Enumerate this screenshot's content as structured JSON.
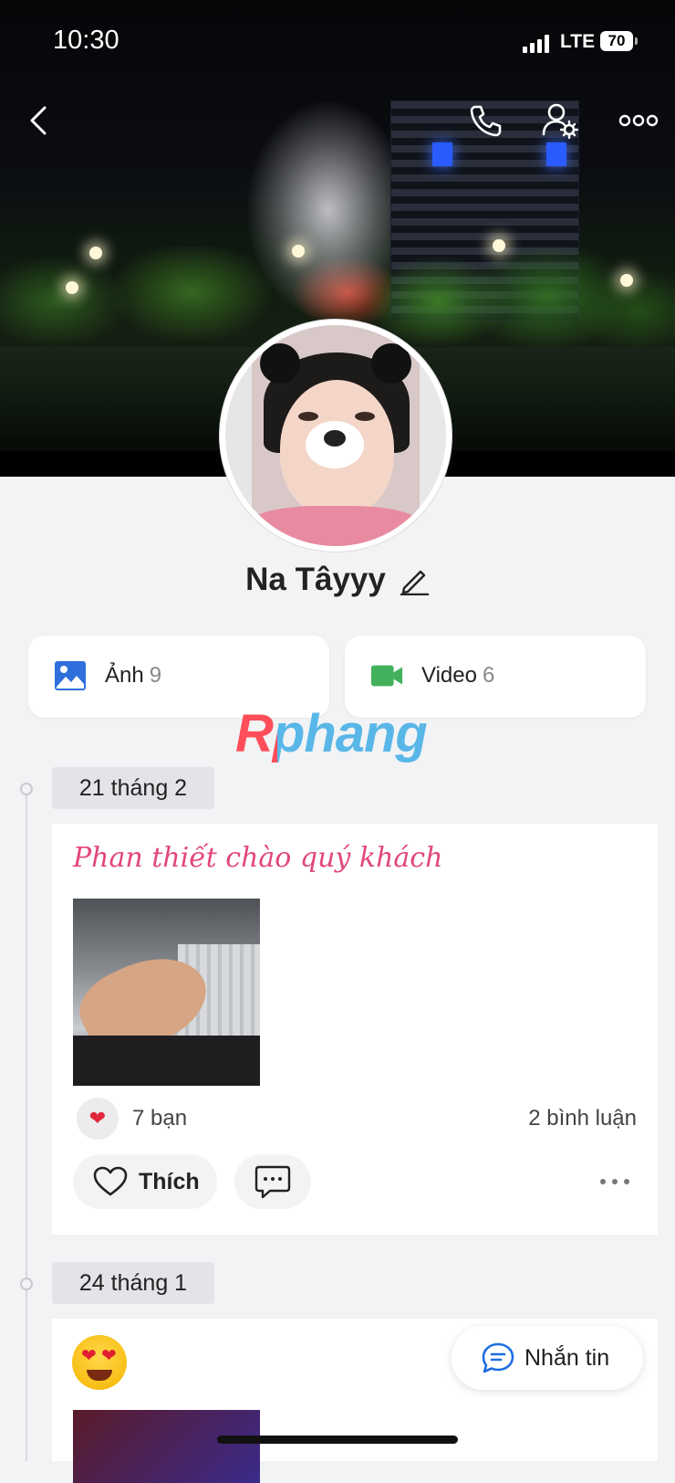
{
  "status_bar": {
    "time": "10:30",
    "network": "LTE",
    "battery": "70"
  },
  "profile": {
    "name": "Na Tâyyy"
  },
  "media": [
    {
      "label": "Ảnh",
      "count": "9"
    },
    {
      "label": "Video",
      "count": "6"
    }
  ],
  "watermark": "Rphang",
  "timeline": [
    {
      "date": "21 tháng 2",
      "title": "Phan thiết chào quý khách",
      "reaction_emoji": "❤",
      "reactions": "7 bạn",
      "comments": "2 bình luận",
      "like_label": "Thích"
    },
    {
      "date": "24 tháng 1",
      "emoji": "😍"
    }
  ],
  "message_button": {
    "label": "Nhắn tin"
  },
  "colors": {
    "accent_pink": "#e2467f",
    "photo_blue": "#2f6fdc",
    "video_green": "#43b05c",
    "message_blue": "#1f6fe0"
  }
}
